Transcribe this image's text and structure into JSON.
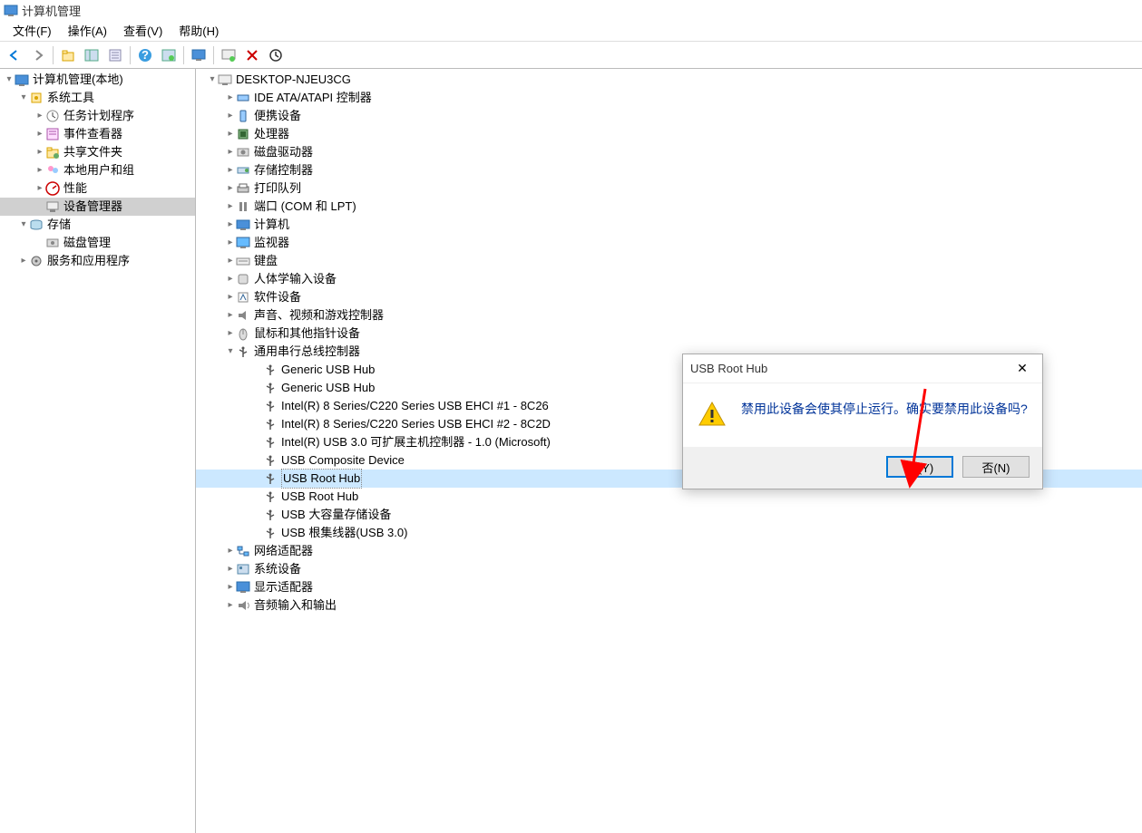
{
  "window": {
    "title": "计算机管理"
  },
  "menu": {
    "file": "文件(F)",
    "action": "操作(A)",
    "view": "查看(V)",
    "help": "帮助(H)"
  },
  "toolbar_icons": {
    "back": "back-icon",
    "forward": "forward-icon",
    "up": "up-icon",
    "show_hide": "show-hide-icon",
    "props": "properties-icon",
    "help": "help-icon",
    "refresh": "refresh-icon",
    "monitor": "monitor-icon",
    "scan": "scan-hardware-icon",
    "disable": "disable-icon",
    "uninstall": "uninstall-icon"
  },
  "left_tree": [
    {
      "ind": 0,
      "caret": "expanded",
      "icon": "computer-mgmt-icon",
      "label": "计算机管理(本地)"
    },
    {
      "ind": 1,
      "caret": "expanded",
      "icon": "system-tools-icon",
      "label": "系统工具"
    },
    {
      "ind": 2,
      "caret": "collapsed",
      "icon": "task-scheduler-icon",
      "label": "任务计划程序"
    },
    {
      "ind": 2,
      "caret": "collapsed",
      "icon": "event-viewer-icon",
      "label": "事件查看器"
    },
    {
      "ind": 2,
      "caret": "collapsed",
      "icon": "shared-folders-icon",
      "label": "共享文件夹"
    },
    {
      "ind": 2,
      "caret": "collapsed",
      "icon": "local-users-icon",
      "label": "本地用户和组"
    },
    {
      "ind": 2,
      "caret": "collapsed",
      "icon": "performance-icon",
      "label": "性能"
    },
    {
      "ind": 2,
      "caret": "none",
      "icon": "device-manager-icon",
      "label": "设备管理器",
      "selected": true
    },
    {
      "ind": 1,
      "caret": "expanded",
      "icon": "storage-icon",
      "label": "存储"
    },
    {
      "ind": 2,
      "caret": "none",
      "icon": "disk-mgmt-icon",
      "label": "磁盘管理"
    },
    {
      "ind": 1,
      "caret": "collapsed",
      "icon": "services-apps-icon",
      "label": "服务和应用程序"
    }
  ],
  "right_tree": [
    {
      "ind": 0,
      "caret": "expanded",
      "icon": "computer-icon",
      "label": "DESKTOP-NJEU3CG"
    },
    {
      "ind": 1,
      "caret": "collapsed",
      "icon": "ide-icon",
      "label": "IDE ATA/ATAPI 控制器"
    },
    {
      "ind": 1,
      "caret": "collapsed",
      "icon": "portable-icon",
      "label": "便携设备"
    },
    {
      "ind": 1,
      "caret": "collapsed",
      "icon": "processor-icon",
      "label": "处理器"
    },
    {
      "ind": 1,
      "caret": "collapsed",
      "icon": "disk-drive-icon",
      "label": "磁盘驱动器"
    },
    {
      "ind": 1,
      "caret": "collapsed",
      "icon": "storage-ctrl-icon",
      "label": "存储控制器"
    },
    {
      "ind": 1,
      "caret": "collapsed",
      "icon": "print-queue-icon",
      "label": "打印队列"
    },
    {
      "ind": 1,
      "caret": "collapsed",
      "icon": "ports-icon",
      "label": "端口 (COM 和 LPT)"
    },
    {
      "ind": 1,
      "caret": "collapsed",
      "icon": "computer-cat-icon",
      "label": "计算机"
    },
    {
      "ind": 1,
      "caret": "collapsed",
      "icon": "monitor-cat-icon",
      "label": "监视器"
    },
    {
      "ind": 1,
      "caret": "collapsed",
      "icon": "keyboard-icon",
      "label": "键盘"
    },
    {
      "ind": 1,
      "caret": "collapsed",
      "icon": "hid-icon",
      "label": "人体学输入设备"
    },
    {
      "ind": 1,
      "caret": "collapsed",
      "icon": "software-dev-icon",
      "label": "软件设备"
    },
    {
      "ind": 1,
      "caret": "collapsed",
      "icon": "sound-video-icon",
      "label": "声音、视频和游戏控制器"
    },
    {
      "ind": 1,
      "caret": "collapsed",
      "icon": "mouse-icon",
      "label": "鼠标和其他指针设备"
    },
    {
      "ind": 1,
      "caret": "expanded",
      "icon": "usb-ctrl-icon",
      "label": "通用串行总线控制器"
    },
    {
      "ind": 2,
      "caret": "none",
      "icon": "usb-icon",
      "label": "Generic USB Hub"
    },
    {
      "ind": 2,
      "caret": "none",
      "icon": "usb-icon",
      "label": "Generic USB Hub"
    },
    {
      "ind": 2,
      "caret": "none",
      "icon": "usb-icon",
      "label": "Intel(R) 8 Series/C220 Series USB EHCI #1 - 8C26"
    },
    {
      "ind": 2,
      "caret": "none",
      "icon": "usb-icon",
      "label": "Intel(R) 8 Series/C220 Series USB EHCI #2 - 8C2D"
    },
    {
      "ind": 2,
      "caret": "none",
      "icon": "usb-icon",
      "label": "Intel(R) USB 3.0 可扩展主机控制器 - 1.0 (Microsoft)"
    },
    {
      "ind": 2,
      "caret": "none",
      "icon": "usb-icon",
      "label": "USB Composite Device"
    },
    {
      "ind": 2,
      "caret": "none",
      "icon": "usb-icon",
      "label": "USB Root Hub",
      "selected": true
    },
    {
      "ind": 2,
      "caret": "none",
      "icon": "usb-icon",
      "label": "USB Root Hub"
    },
    {
      "ind": 2,
      "caret": "none",
      "icon": "usb-icon",
      "label": "USB 大容量存储设备"
    },
    {
      "ind": 2,
      "caret": "none",
      "icon": "usb-icon",
      "label": "USB 根集线器(USB 3.0)"
    },
    {
      "ind": 1,
      "caret": "collapsed",
      "icon": "network-icon",
      "label": "网络适配器"
    },
    {
      "ind": 1,
      "caret": "collapsed",
      "icon": "system-dev-icon",
      "label": "系统设备"
    },
    {
      "ind": 1,
      "caret": "collapsed",
      "icon": "display-icon",
      "label": "显示适配器"
    },
    {
      "ind": 1,
      "caret": "collapsed",
      "icon": "audio-io-icon",
      "label": "音频输入和输出"
    }
  ],
  "dialog": {
    "title": "USB Root Hub",
    "message": "禁用此设备会使其停止运行。确实要禁用此设备吗?",
    "yes": "是(Y)",
    "no": "否(N)"
  }
}
